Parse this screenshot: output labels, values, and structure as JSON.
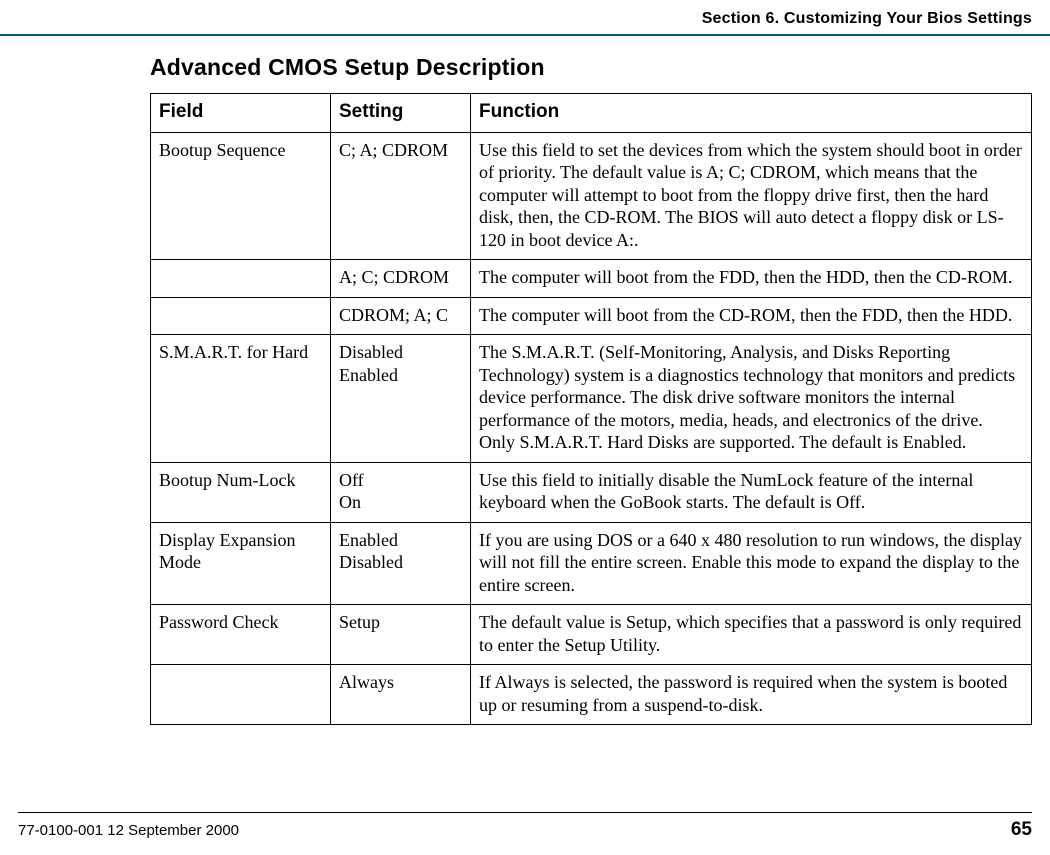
{
  "running_head": "Section 6. Customizing Your Bios Settings",
  "title": "Advanced CMOS Setup Description",
  "headers": {
    "field": "Field",
    "setting": "Setting",
    "function": "Function"
  },
  "rows": [
    {
      "field": "Bootup Sequence",
      "setting": "C; A; CDROM",
      "function": "Use this field to set the devices from which the system should boot in order of priority. The default value is A; C; CDROM, which means that the computer will attempt to boot from the floppy drive first, then the hard disk, then, the CD-ROM. The BIOS will auto detect a floppy disk or LS-120 in boot device A:."
    },
    {
      "field": "",
      "setting": "A; C; CDROM",
      "function": "The computer will boot from the FDD, then the HDD, then the CD-ROM."
    },
    {
      "field": "",
      "setting": "CDROM; A; C",
      "function": "The computer will boot from the CD-ROM, then the FDD, then the HDD."
    },
    {
      "field": "S.M.A.R.T. for Hard",
      "setting": "Disabled\nEnabled",
      "function": "The S.M.A.R.T. (Self-Monitoring, Analysis, and Disks Reporting Technology) system is a diagnostics technology that monitors and predicts device performance. The disk drive software monitors the internal performance of the motors, media, heads, and electronics of the drive. Only S.M.A.R.T. Hard Disks are supported. The default is Enabled."
    },
    {
      "field": "Bootup Num-Lock",
      "setting": "Off\nOn",
      "function": "Use this field to initially disable the NumLock feature of the internal keyboard when the GoBook starts. The default is Off."
    },
    {
      "field": "Display Expansion Mode",
      "setting": "Enabled\nDisabled",
      "function": "If you are using DOS or a 640 x 480 resolution to run windows, the display will not fill the entire screen. Enable this mode to expand the display to the entire screen."
    },
    {
      "field": "Password Check",
      "setting": "Setup",
      "function": "The default value is Setup, which specifies that a password is only required to enter the Setup Utility."
    },
    {
      "field": "",
      "setting": "Always",
      "function": "If Always is selected, the password is required when the system is booted up or resuming from a suspend-to-disk."
    }
  ],
  "footer": {
    "docid": "77-0100-001   12 September 2000",
    "page": "65"
  }
}
